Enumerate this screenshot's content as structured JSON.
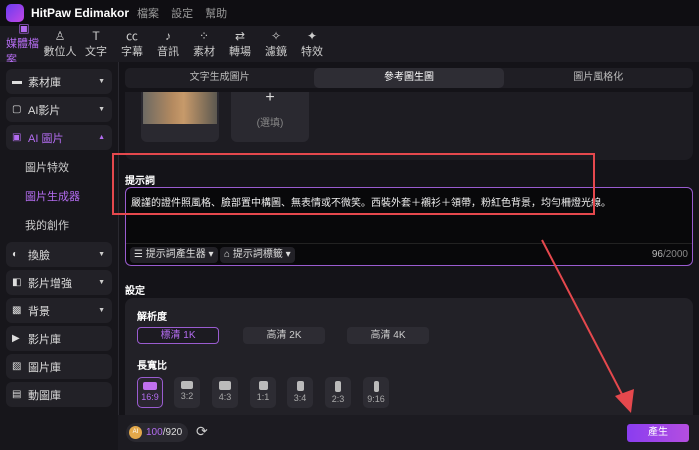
{
  "app": {
    "title": "HitPaw Edimakor",
    "menu": [
      "檔案",
      "設定",
      "幫助"
    ]
  },
  "toolbar": [
    {
      "label": "媒體檔案",
      "icon": "media-icon",
      "active": true
    },
    {
      "label": "數位人",
      "icon": "avatar-icon"
    },
    {
      "label": "文字",
      "icon": "text-icon"
    },
    {
      "label": "字幕",
      "icon": "caption-icon"
    },
    {
      "label": "音訊",
      "icon": "music-icon"
    },
    {
      "label": "素材",
      "icon": "elements-icon"
    },
    {
      "label": "轉場",
      "icon": "transition-icon"
    },
    {
      "label": "濾鏡",
      "icon": "filter-icon"
    },
    {
      "label": "特效",
      "icon": "effects-icon"
    }
  ],
  "sidebar": {
    "items": [
      {
        "label": "素材庫",
        "icon": "folder-icon"
      },
      {
        "label": "AI影片",
        "icon": "ai-video-icon"
      },
      {
        "label": "AI 圖片",
        "icon": "ai-image-icon",
        "active": true
      },
      {
        "label": "換臉",
        "icon": "face-swap-icon"
      },
      {
        "label": "影片增強",
        "icon": "video-enhance-icon"
      },
      {
        "label": "背景",
        "icon": "background-icon"
      },
      {
        "label": "影片庫",
        "icon": "video-library-icon"
      },
      {
        "label": "圖片庫",
        "icon": "image-library-icon"
      },
      {
        "label": "動圖庫",
        "icon": "gif-library-icon"
      }
    ],
    "subitems": [
      {
        "label": "圖片特效"
      },
      {
        "label": "圖片生成器",
        "active": true
      },
      {
        "label": "我的創作"
      }
    ]
  },
  "tabs": [
    {
      "label": "文字生成圖片"
    },
    {
      "label": "參考圖生圖",
      "active": true
    },
    {
      "label": "圖片風格化"
    }
  ],
  "upload": {
    "add_label": "+",
    "optional": "(選填)"
  },
  "prompt": {
    "label": "提示詞",
    "text": "嚴謹的證件照風格、臉部置中構圖、無表情或不微笑。西裝外套＋襯衫＋領帶，粉紅色背景，均勻柵燈光線。",
    "generator": "提示詞產生器",
    "tags": "提示詞標籤",
    "count": "96",
    "max": "/2000"
  },
  "settings": {
    "label": "設定",
    "resolution_label": "解析度",
    "resolutions": [
      "標清 1K",
      "高清 2K",
      "高清 4K"
    ],
    "selected_resolution": "標清 1K",
    "aspect_label": "長寬比",
    "aspects": [
      "16:9",
      "3:2",
      "4:3",
      "1:1",
      "3:4",
      "2:3",
      "9:16"
    ],
    "selected_aspect": "16:9"
  },
  "bottom": {
    "credits": "100",
    "credits_total": "/920",
    "generate": "產生"
  },
  "colors": {
    "accent": "#b36cf0",
    "annotation": "#e5484d"
  }
}
